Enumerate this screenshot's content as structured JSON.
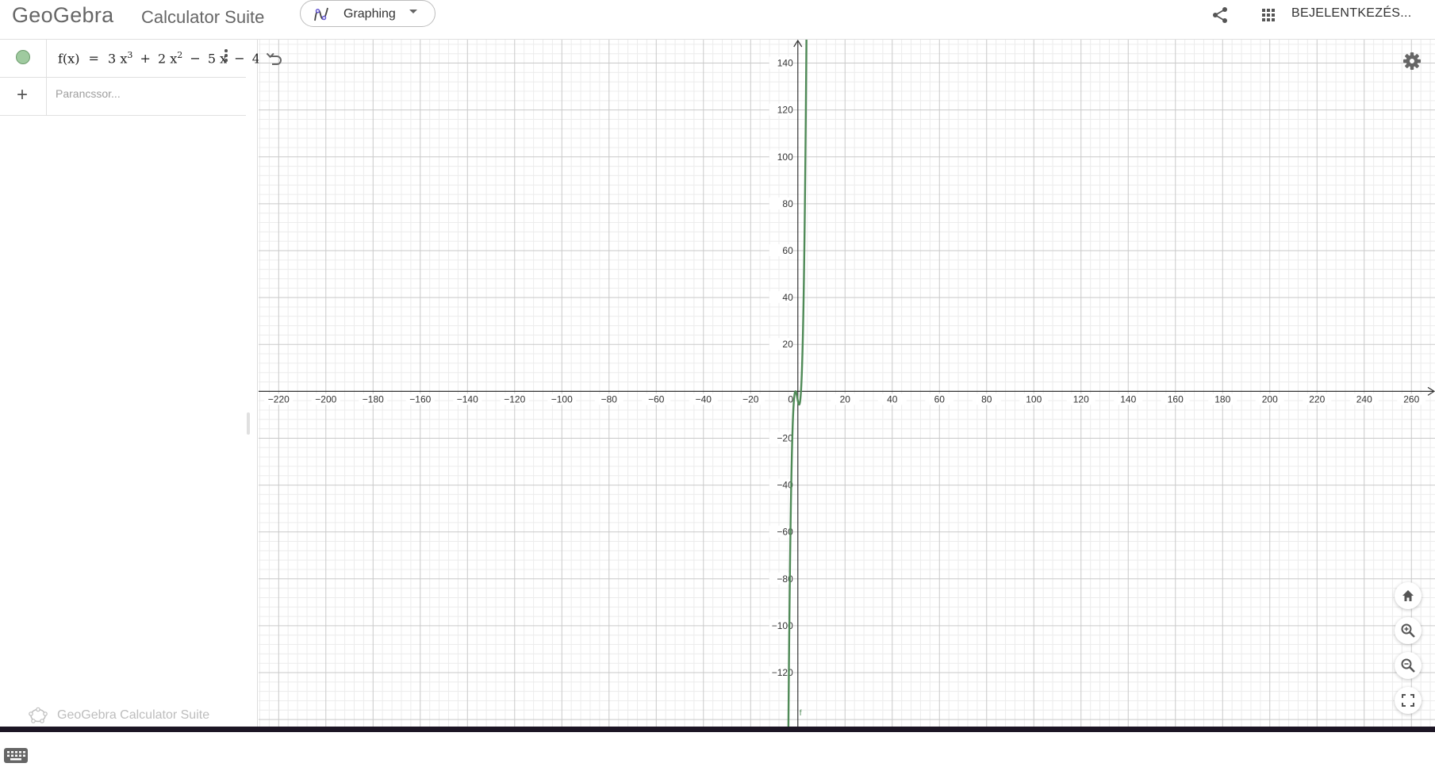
{
  "header": {
    "logo_text": "GeoGebra",
    "suite_title": "Calculator Suite",
    "app_picker_label": "Graphing",
    "login_label": "BEJELENTKEZÉS...",
    "icons": [
      "graphing-icon",
      "caret-down-icon",
      "share-icon",
      "apps-grid-icon"
    ]
  },
  "algebra": {
    "rows": [
      {
        "color": "#9fca9f",
        "expression": "f(x) = 3x³ + 2x² − 5x − 4",
        "expression_parts": {
          "lhs": "f(x)",
          "eq": "=",
          "t1": "3",
          "v1": "x",
          "e1": "3",
          "op1": "+",
          "t2": "2",
          "v2": "x",
          "e2": "2",
          "op2": "−",
          "t3": "5",
          "v3": "x",
          "op3": "−",
          "t4": "4"
        }
      }
    ],
    "input_placeholder": "Parancssor...",
    "watermark": "GeoGebra Calculator Suite"
  },
  "graph": {
    "x_ticks": [
      -220,
      -200,
      -180,
      -160,
      -140,
      -120,
      -100,
      -80,
      -60,
      -40,
      -20,
      0,
      20,
      40,
      60,
      80,
      100,
      120,
      140,
      160,
      180,
      200,
      220,
      240,
      260
    ],
    "y_ticks": [
      140,
      120,
      100,
      80,
      60,
      40,
      20,
      -20,
      -40,
      -60,
      -80,
      -100,
      -120
    ],
    "x_range": [
      -228.5,
      270
    ],
    "y_range": [
      -143,
      150
    ],
    "function": {
      "name": "f",
      "coefficients": [
        3,
        2,
        -5,
        -4
      ],
      "color": "#4f8a57"
    },
    "axis_label_color": "#333333",
    "grid_major_color": "#c9c9c9",
    "grid_minor_color": "#ececec",
    "buttons": [
      "undo-icon",
      "settings-icon",
      "home-icon",
      "zoom-in-icon",
      "zoom-out-icon",
      "fullscreen-icon"
    ]
  }
}
